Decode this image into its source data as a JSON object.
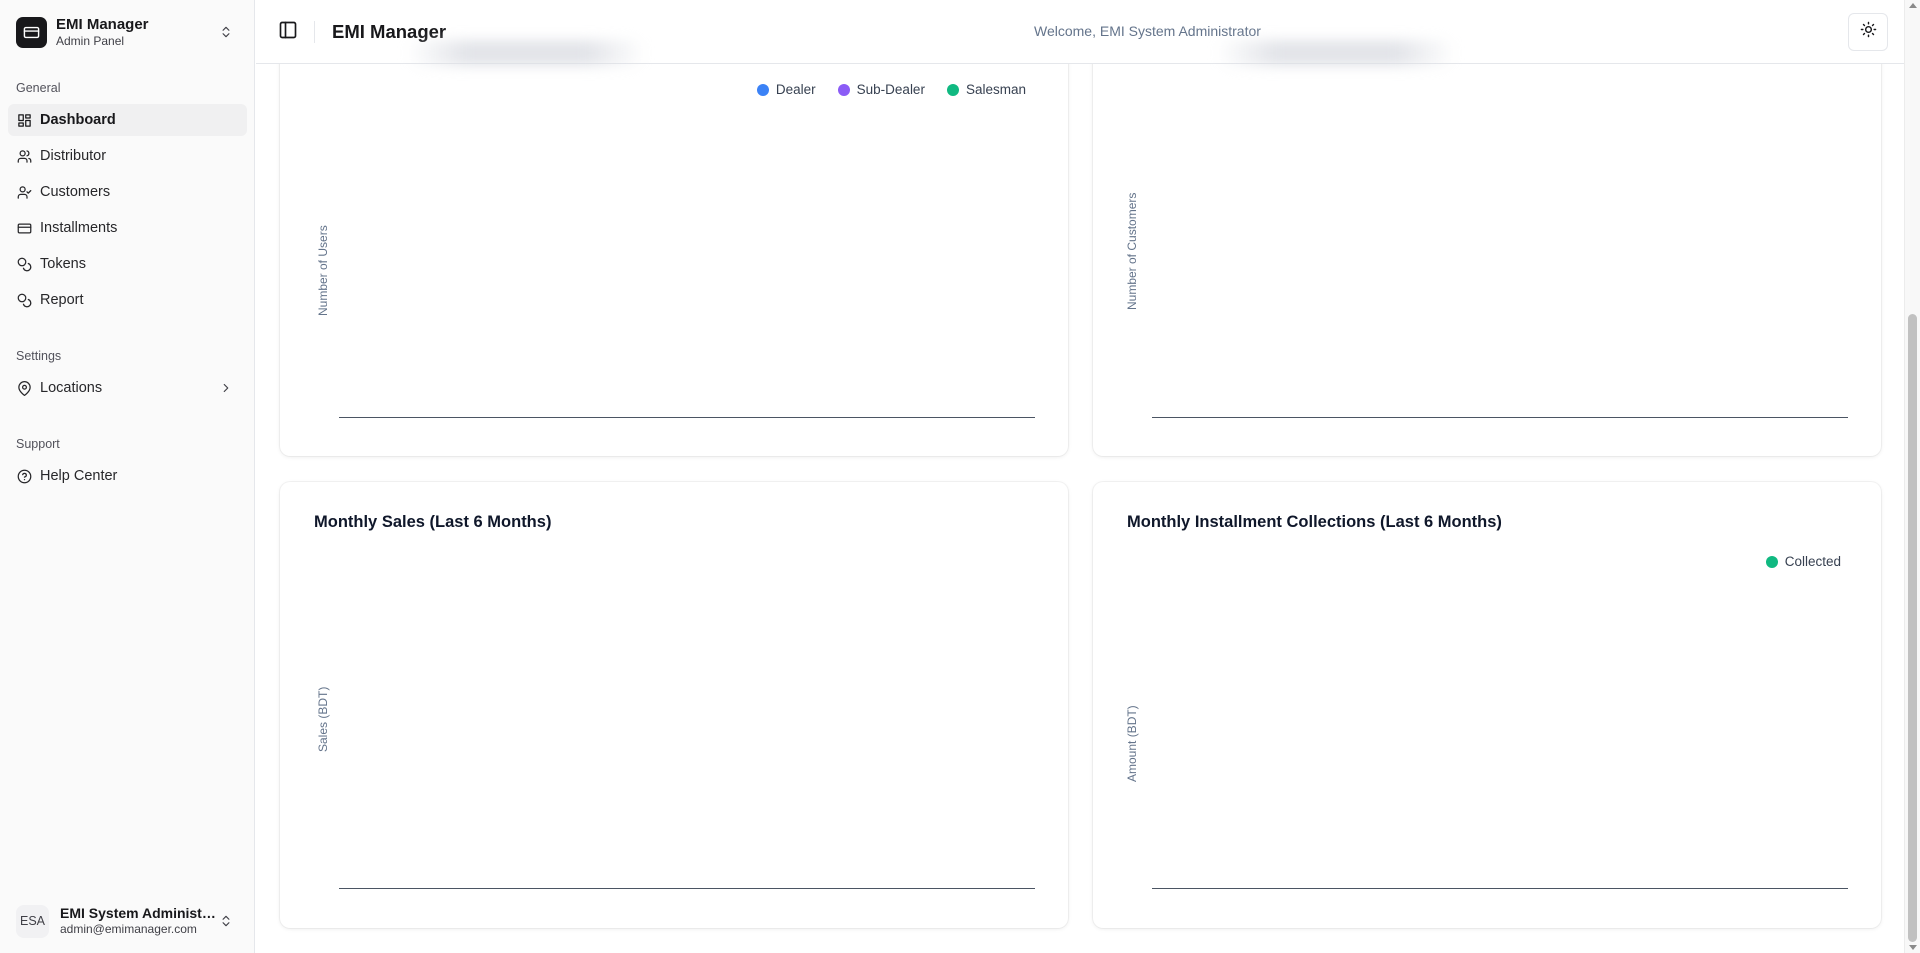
{
  "app": {
    "name": "EMI Manager",
    "subtitle": "Admin Panel"
  },
  "sidebar": {
    "groups": [
      {
        "label": "General",
        "items": [
          {
            "label": "Dashboard",
            "icon": "dashboard-icon",
            "active": true
          },
          {
            "label": "Distributor",
            "icon": "users-icon"
          },
          {
            "label": "Customers",
            "icon": "user-check-icon"
          },
          {
            "label": "Installments",
            "icon": "credit-card-icon"
          },
          {
            "label": "Tokens",
            "icon": "coins-icon"
          },
          {
            "label": "Report",
            "icon": "coins-icon"
          }
        ]
      },
      {
        "label": "Settings",
        "items": [
          {
            "label": "Locations",
            "icon": "map-pin-icon",
            "has_submenu": true
          }
        ]
      },
      {
        "label": "Support",
        "items": [
          {
            "label": "Help Center",
            "icon": "help-circle-icon"
          }
        ]
      }
    ],
    "user": {
      "initials": "ESA",
      "name": "EMI System Administra...",
      "email": "admin@emimanager.com"
    }
  },
  "header": {
    "title": "EMI Manager",
    "welcome": "Welcome, EMI System Administrator"
  },
  "colors": {
    "dealer": "#3b82f6",
    "sub_dealer": "#8b5cf6",
    "salesman": "#10b981",
    "collected": "#10b981"
  },
  "charts": {
    "users": {
      "legend": [
        "Dealer",
        "Sub-Dealer",
        "Salesman"
      ],
      "ylabel": "Number of Users"
    },
    "customers": {
      "ylabel": "Number of Customers"
    },
    "sales": {
      "title": "Monthly Sales (Last 6 Months)",
      "ylabel": "Sales (BDT)"
    },
    "collections": {
      "title": "Monthly Installment Collections (Last 6 Months)",
      "legend": [
        "Collected"
      ],
      "ylabel": "Amount (BDT)"
    }
  },
  "chart_data": [
    {
      "type": "bar",
      "title": "",
      "xlabel": "",
      "ylabel": "Number of Users",
      "legend": [
        "Dealer",
        "Sub-Dealer",
        "Salesman"
      ],
      "categories": [],
      "series": [
        {
          "name": "Dealer",
          "values": []
        },
        {
          "name": "Sub-Dealer",
          "values": []
        },
        {
          "name": "Salesman",
          "values": []
        }
      ],
      "grid": false,
      "legend_position": "top-right"
    },
    {
      "type": "bar",
      "title": "",
      "xlabel": "",
      "ylabel": "Number of Customers",
      "categories": [],
      "values": [],
      "grid": false
    },
    {
      "type": "bar",
      "title": "Monthly Sales (Last 6 Months)",
      "xlabel": "",
      "ylabel": "Sales (BDT)",
      "categories": [],
      "values": [],
      "grid": false
    },
    {
      "type": "bar",
      "title": "Monthly Installment Collections (Last 6 Months)",
      "xlabel": "",
      "ylabel": "Amount (BDT)",
      "legend": [
        "Collected"
      ],
      "categories": [],
      "series": [
        {
          "name": "Collected",
          "values": []
        }
      ],
      "grid": false,
      "legend_position": "top-right"
    }
  ]
}
